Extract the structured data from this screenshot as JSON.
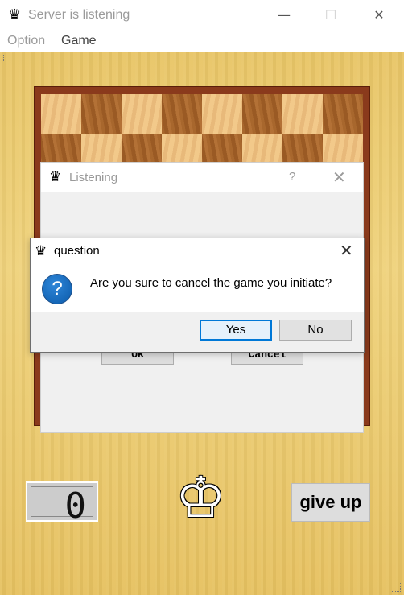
{
  "window": {
    "title": "Server is listening",
    "minimize": "—",
    "maximize": "☐",
    "close": "✕"
  },
  "menu": {
    "items": [
      "Option",
      "Game"
    ]
  },
  "board": {
    "top_rows": [
      [
        "light",
        "dark",
        "light",
        "dark",
        "light",
        "dark",
        "light",
        "dark"
      ],
      [
        "dark",
        "light",
        "dark",
        "light",
        "dark",
        "light",
        "dark",
        "light"
      ]
    ]
  },
  "listening_dialog": {
    "title": "Listening",
    "help": "?",
    "close": "✕",
    "ok_label": "OK",
    "cancel_label": "Cancel"
  },
  "question_dialog": {
    "title": "question",
    "close": "✕",
    "icon": "?",
    "message": "Are you sure to cancel the game you initiate?",
    "yes_label": "Yes",
    "no_label": "No"
  },
  "status": {
    "score": "0",
    "king_glyph": "♔",
    "give_up_label": "give up"
  },
  "icons": {
    "app_icon": "queen-icon",
    "question_icon": "question-icon"
  }
}
